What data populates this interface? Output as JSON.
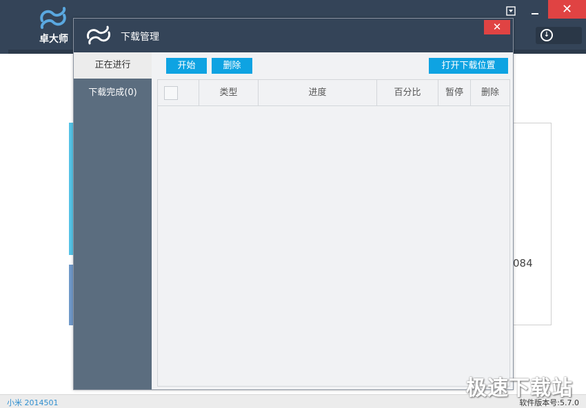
{
  "app": {
    "logo_text": "卓大师",
    "partial_number": "084",
    "status_left": "小米 2014501",
    "status_right": "软件版本号:5.7.0",
    "watermark": "极速下载站",
    "icons": {
      "menu": "dropdown-menu-icon",
      "minimize": "minimize-icon",
      "close": "close-icon",
      "download": "download-icon"
    }
  },
  "dialog": {
    "title": "下载管理",
    "sidebar": [
      {
        "label": "正在进行",
        "active": true
      },
      {
        "label": "下载完成(0)",
        "active": false
      }
    ],
    "toolbar": {
      "start_label": "开始",
      "delete_label": "删除",
      "open_location_label": "打开下载位置"
    },
    "table": {
      "columns": [
        "类型",
        "进度",
        "百分比",
        "暂停",
        "删除"
      ],
      "rows": []
    }
  },
  "colors": {
    "header_bg": "#344458",
    "sidebar_bg": "#5b6d7f",
    "button_blue": "#0ea3e2",
    "close_red": "#e04343"
  }
}
